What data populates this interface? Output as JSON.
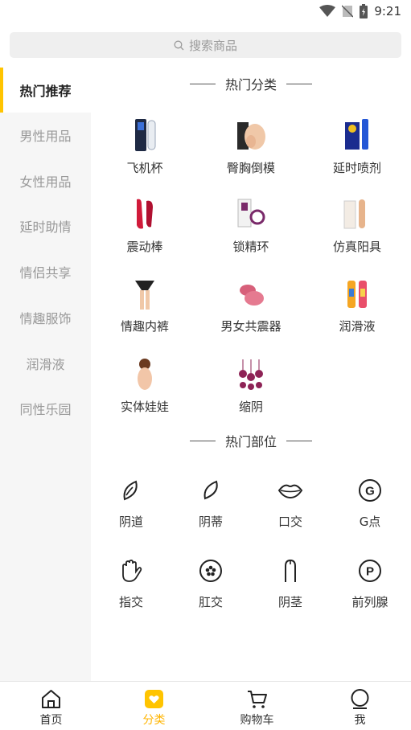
{
  "status_bar": {
    "time": "9:21"
  },
  "search": {
    "placeholder": "搜索商品"
  },
  "sidebar": {
    "items": [
      {
        "label": "热门推荐",
        "active": true
      },
      {
        "label": "男性用品"
      },
      {
        "label": "女性用品"
      },
      {
        "label": "延时助情"
      },
      {
        "label": "情侣共享"
      },
      {
        "label": "情趣服饰"
      },
      {
        "label": "润滑液"
      },
      {
        "label": "同性乐园"
      }
    ]
  },
  "hot_categories": {
    "title": "热门分类",
    "items": [
      {
        "label": "飞机杯"
      },
      {
        "label": "臀胸倒模"
      },
      {
        "label": "延时喷剂"
      },
      {
        "label": "震动棒"
      },
      {
        "label": "锁精环"
      },
      {
        "label": "仿真阳具"
      },
      {
        "label": "情趣内裤"
      },
      {
        "label": "男女共震器"
      },
      {
        "label": "润滑液"
      },
      {
        "label": "实体娃娃"
      },
      {
        "label": "缩阴"
      }
    ]
  },
  "hot_parts": {
    "title": "热门部位",
    "items": [
      {
        "label": "阴道",
        "icon": "leaf-icon"
      },
      {
        "label": "阴蒂",
        "icon": "petal-icon"
      },
      {
        "label": "口交",
        "icon": "lips-icon"
      },
      {
        "label": "G点",
        "icon": "g-circle-icon"
      },
      {
        "label": "指交",
        "icon": "hand-icon"
      },
      {
        "label": "肛交",
        "icon": "flower-circle-icon"
      },
      {
        "label": "阴茎",
        "icon": "shaft-icon"
      },
      {
        "label": "前列腺",
        "icon": "p-circle-icon"
      }
    ]
  },
  "tabbar": {
    "items": [
      {
        "label": "首页",
        "icon": "home-icon"
      },
      {
        "label": "分类",
        "icon": "category-icon",
        "active": true
      },
      {
        "label": "购物车",
        "icon": "cart-icon"
      },
      {
        "label": "我",
        "icon": "user-icon"
      }
    ]
  },
  "colors": {
    "accent": "#ffc400",
    "active_tab_text": "#ffb400",
    "sidebar_bg": "#f6f6f6"
  }
}
